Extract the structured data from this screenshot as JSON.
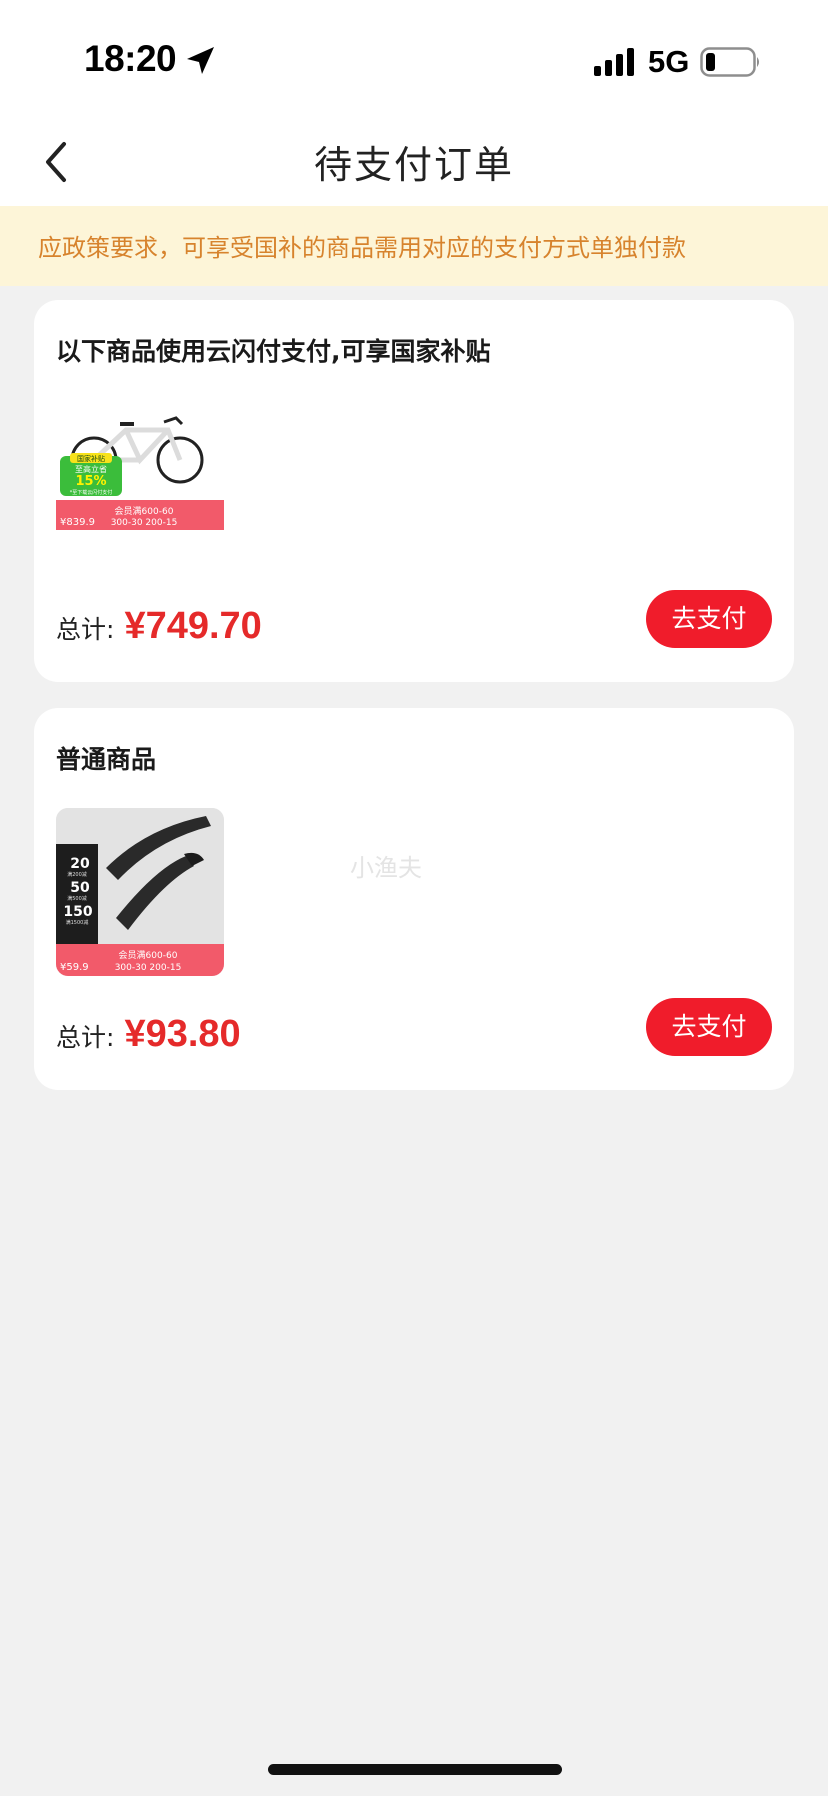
{
  "status_bar": {
    "time": "18:20",
    "network": "5G"
  },
  "nav": {
    "title": "待支付订单"
  },
  "notice": {
    "text": "应政策要求，可享受国补的商品需用对应的支付方式单独付款"
  },
  "orders": [
    {
      "title": "以下商品使用云闪付支付,可享国家补贴",
      "total_label": "总计:",
      "total_price": "¥749.70",
      "pay_label": "去支付",
      "thumb": {
        "badge_top": "国家补贴",
        "badge_mid": "至高立省",
        "badge_pct": "15%",
        "badge_note": "*至下载云闪付支付",
        "price": "¥839.9",
        "promo_1": "会员满600-60",
        "promo_2": "300-30 200-15"
      }
    },
    {
      "title": "普通商品",
      "total_label": "总计:",
      "total_price": "¥93.80",
      "pay_label": "去支付",
      "thumb": {
        "coupon_1": "20",
        "coupon_1_note": "满200减",
        "coupon_2": "50",
        "coupon_2_note": "满500减",
        "coupon_3": "150",
        "coupon_3_note": "满1500减",
        "price": "¥59.9",
        "promo_1": "会员满600-60",
        "promo_2": "300-30 200-15"
      }
    }
  ],
  "watermark": "小渔夫"
}
